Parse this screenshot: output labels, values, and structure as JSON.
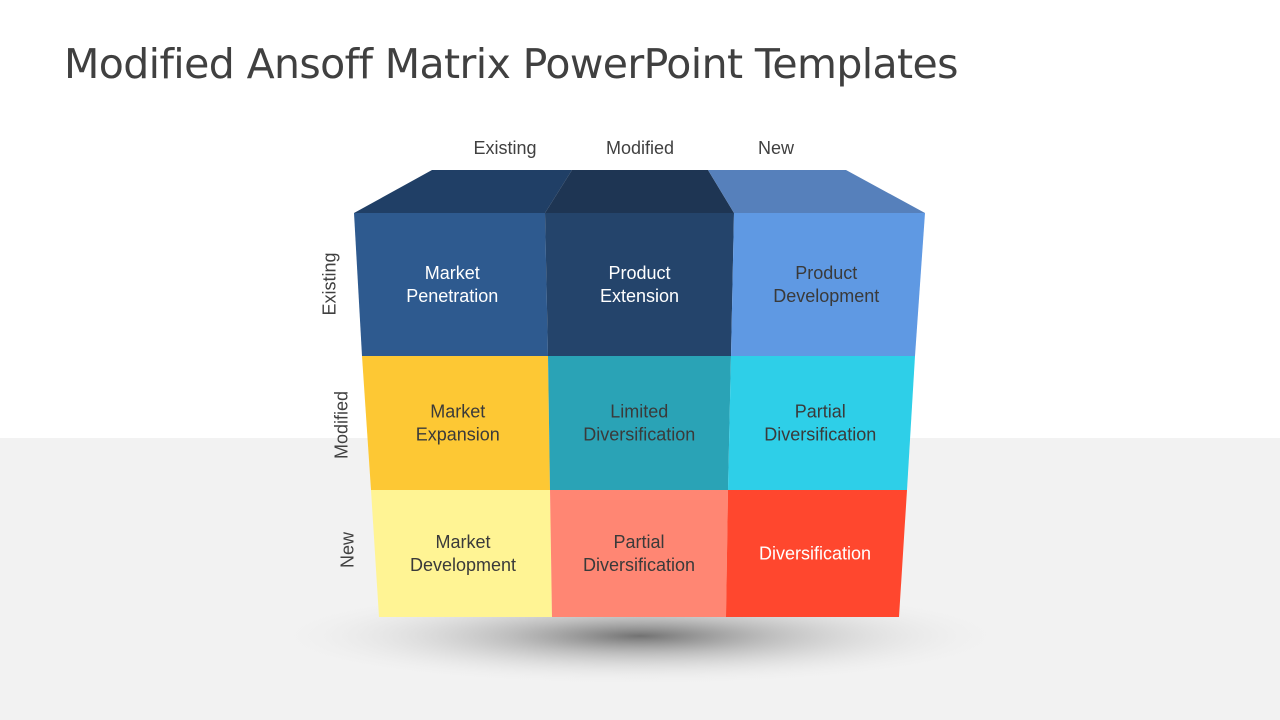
{
  "title": "Modified Ansoff Matrix PowerPoint Templates",
  "columns": [
    "Existing",
    "Modified",
    "New"
  ],
  "rows": [
    "Existing",
    "Modified",
    "New"
  ],
  "top_colors": [
    "#203f66",
    "#1e3553",
    "#5680bb"
  ],
  "cells": [
    [
      {
        "lines": [
          "Market",
          "Penetration"
        ],
        "color": "#2e5a8f",
        "text_color": "#ffffff"
      },
      {
        "lines": [
          "Product",
          "Extension"
        ],
        "color": "#24446b",
        "text_color": "#ffffff"
      },
      {
        "lines": [
          "Product",
          "Development"
        ],
        "color": "#5f99e3",
        "text_color": "#3a3a3a"
      }
    ],
    [
      {
        "lines": [
          "Market",
          "Expansion"
        ],
        "color": "#fdc834",
        "text_color": "#3a3a3a"
      },
      {
        "lines": [
          "Limited",
          "Diversification"
        ],
        "color": "#2aa3b6",
        "text_color": "#3a3a3a"
      },
      {
        "lines": [
          "Partial",
          "Diversification"
        ],
        "color": "#2ecfe8",
        "text_color": "#3a3a3a"
      }
    ],
    [
      {
        "lines": [
          "Market",
          "Development"
        ],
        "color": "#fff494",
        "text_color": "#3a3a3a"
      },
      {
        "lines": [
          "Partial",
          "Diversification"
        ],
        "color": "#ff8673",
        "text_color": "#3a3a3a"
      },
      {
        "lines": [
          "Diversification"
        ],
        "color": "#ff472e",
        "text_color": "#ffffff"
      }
    ]
  ]
}
